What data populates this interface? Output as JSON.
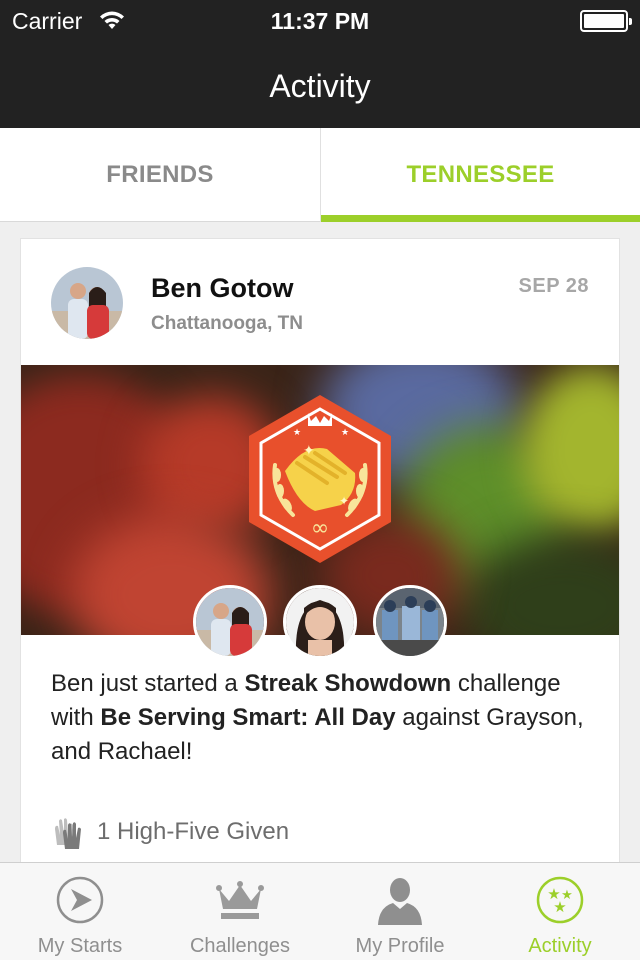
{
  "status_bar": {
    "carrier": "Carrier",
    "time": "11:37 PM"
  },
  "nav": {
    "title": "Activity"
  },
  "segments": [
    {
      "label": "FRIENDS",
      "active": false
    },
    {
      "label": "TENNESSEE",
      "active": true
    }
  ],
  "colors": {
    "accent": "#9ccf2a",
    "nav_bg": "#222222",
    "badge": "#e8502c"
  },
  "post": {
    "author": "Ben Gotow",
    "location": "Chattanooga, TN",
    "date": "SEP 28",
    "story": {
      "part1": "Ben just started a ",
      "challenge_type": "Streak Showdown",
      "part2": " challenge with ",
      "challenge_name": "Be Serving Smart: All Day",
      "part3": " against Grayson, and Rachael!"
    },
    "high_fives": "1 High-Five Given",
    "badge_icon": "handshake-badge-icon"
  },
  "tabbar": [
    {
      "label": "My Starts",
      "icon": "play-arrow-icon",
      "active": false
    },
    {
      "label": "Challenges",
      "icon": "crown-icon",
      "active": false
    },
    {
      "label": "My Profile",
      "icon": "person-icon",
      "active": false
    },
    {
      "label": "Activity",
      "icon": "stars-icon",
      "active": true
    }
  ]
}
